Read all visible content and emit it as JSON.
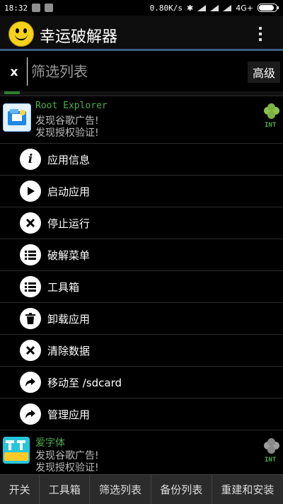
{
  "status_bar": {
    "time": "18:32",
    "network_speed": "0.80K/s",
    "network_type": "4G+",
    "battery_level": 0.8
  },
  "app": {
    "title": "幸运破解器"
  },
  "search": {
    "clear_label": "x",
    "placeholder": "筛选列表",
    "advanced_label": "高级"
  },
  "apps": [
    {
      "name": "Root Explorer",
      "line1": "发现谷歌广告!",
      "line2": "发现授权验证!",
      "badge": "INT",
      "icon": "root-explorer-icon",
      "clover_color": "#8bc34a"
    },
    {
      "name": "爱字体",
      "line1": "发现谷歌广告!",
      "line2": "发现授权验证!",
      "badge": "INT",
      "icon": "ifont-icon",
      "clover_color": "#9e9e9e"
    }
  ],
  "context_menu": [
    {
      "label": "应用信息",
      "icon": "info-icon"
    },
    {
      "label": "启动应用",
      "icon": "play-icon"
    },
    {
      "label": "停止运行",
      "icon": "close-icon"
    },
    {
      "label": "破解菜单",
      "icon": "list-icon"
    },
    {
      "label": "工具箱",
      "icon": "list-icon"
    },
    {
      "label": "卸载应用",
      "icon": "trash-icon"
    },
    {
      "label": "清除数据",
      "icon": "close-icon"
    },
    {
      "label": "移动至 /sdcard",
      "icon": "share-arrow-icon"
    },
    {
      "label": "管理应用",
      "icon": "share-arrow-icon"
    }
  ],
  "toolbar": [
    {
      "label": "开关"
    },
    {
      "label": "工具箱"
    },
    {
      "label": "筛选列表"
    },
    {
      "label": "备份列表"
    },
    {
      "label": "重建和安装"
    }
  ],
  "colors": {
    "accent": "#3d5d82",
    "app_name": "#4caf50",
    "toolbar_bg": "#2b2b2b"
  }
}
